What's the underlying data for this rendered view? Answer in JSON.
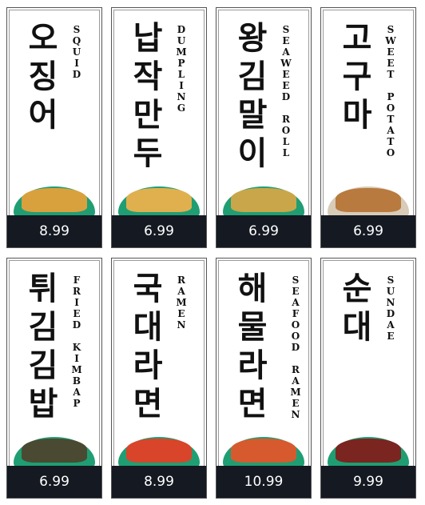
{
  "items": [
    {
      "korean": [
        "오",
        "징",
        "어"
      ],
      "english": "SQUID",
      "price": "8.99",
      "food": "fried-squid"
    },
    {
      "korean": [
        "납",
        "작",
        "만",
        "두"
      ],
      "english": "DUMPLING",
      "price": "6.99",
      "food": "flat-dumpling"
    },
    {
      "korean": [
        "왕",
        "김",
        "말",
        "이"
      ],
      "english": "SEAWEED ROLL",
      "price": "6.99",
      "food": "seaweed-roll"
    },
    {
      "korean": [
        "고",
        "구",
        "마"
      ],
      "english": "SWEET POTATO",
      "price": "6.99",
      "food": "sweet-potato"
    },
    {
      "korean": [
        "튀",
        "김",
        "김",
        "밥"
      ],
      "english": "FRIED KIMBAP",
      "price": "6.99",
      "food": "fried-kimbap"
    },
    {
      "korean": [
        "국",
        "대",
        "라",
        "면"
      ],
      "english": "RAMEN",
      "price": "8.99",
      "food": "ramen"
    },
    {
      "korean": [
        "해",
        "물",
        "라",
        "면"
      ],
      "english": "SEAFOOD RAMEN",
      "price": "10.99",
      "food": "seafood-ramen"
    },
    {
      "korean": [
        "순",
        "대"
      ],
      "english": "SUNDAE",
      "price": "9.99",
      "food": "sundae"
    }
  ],
  "colors": {
    "plate": "#1f9e73",
    "price_bar": "#141922",
    "fried": "#d9a13d",
    "ramen": "#d8452b",
    "sundae": "#7a2520",
    "kimbap": "#3a3a2a"
  }
}
